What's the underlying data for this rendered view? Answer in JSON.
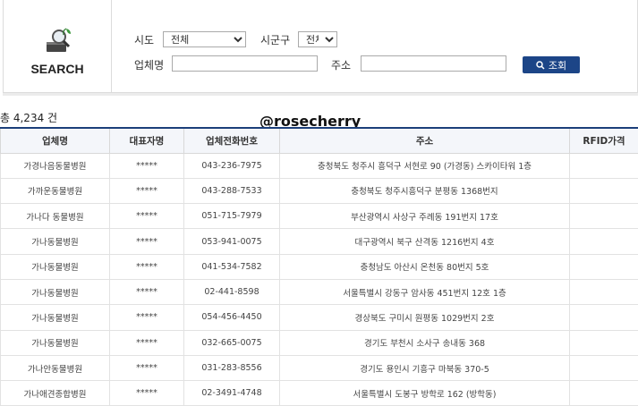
{
  "search": {
    "label": "SEARCH",
    "sido_label": "시도",
    "sido_value": "전체",
    "sigungu_label": "시군구",
    "sigungu_value": "전체",
    "company_label": "업체명",
    "company_value": "",
    "address_label": "주소",
    "address_value": "",
    "button_label": "조회"
  },
  "summary": {
    "total": "총 4,234 건"
  },
  "watermark": "@rosecherry",
  "table": {
    "headers": [
      "업체명",
      "대표자명",
      "업체전화번호",
      "주소",
      "RFID가격"
    ],
    "rows": [
      [
        "가경나음동물병원",
        "*****",
        "043-236-7975",
        "충청북도 청주시 흥덕구 서현로 90 (가경동) 스카이타워 1층",
        ""
      ],
      [
        "가까운동물병원",
        "*****",
        "043-288-7533",
        "충청북도 청주시흥덕구 분평동 1368번지",
        ""
      ],
      [
        "가나다 동물병원",
        "*****",
        "051-715-7979",
        "부산광역시 사상구 주례동 191번지 17호",
        ""
      ],
      [
        "가나동물병원",
        "*****",
        "053-941-0075",
        "대구광역시 북구 산격동 1216번지 4호",
        ""
      ],
      [
        "가나동물병원",
        "*****",
        "041-534-7582",
        "충청남도 아산시 온천동 80번지 5호",
        ""
      ],
      [
        "가나동물병원",
        "*****",
        "02-441-8598",
        "서울특별시 강동구 암사동 451번지 12호 1층",
        ""
      ],
      [
        "가나동물병원",
        "*****",
        "054-456-4450",
        "경상북도 구미시 원평동 1029번지 2호",
        ""
      ],
      [
        "가나동물병원",
        "*****",
        "032-665-0075",
        "경기도 부천시 소사구 송내동 368",
        ""
      ],
      [
        "가나안동물병원",
        "*****",
        "031-283-8556",
        "경기도 용인시 기흥구 마북동 370-5",
        ""
      ],
      [
        "가나애견종합병원",
        "*****",
        "02-3491-4748",
        "서울특별시 도봉구 방학로 162 (방학동)",
        ""
      ]
    ]
  }
}
